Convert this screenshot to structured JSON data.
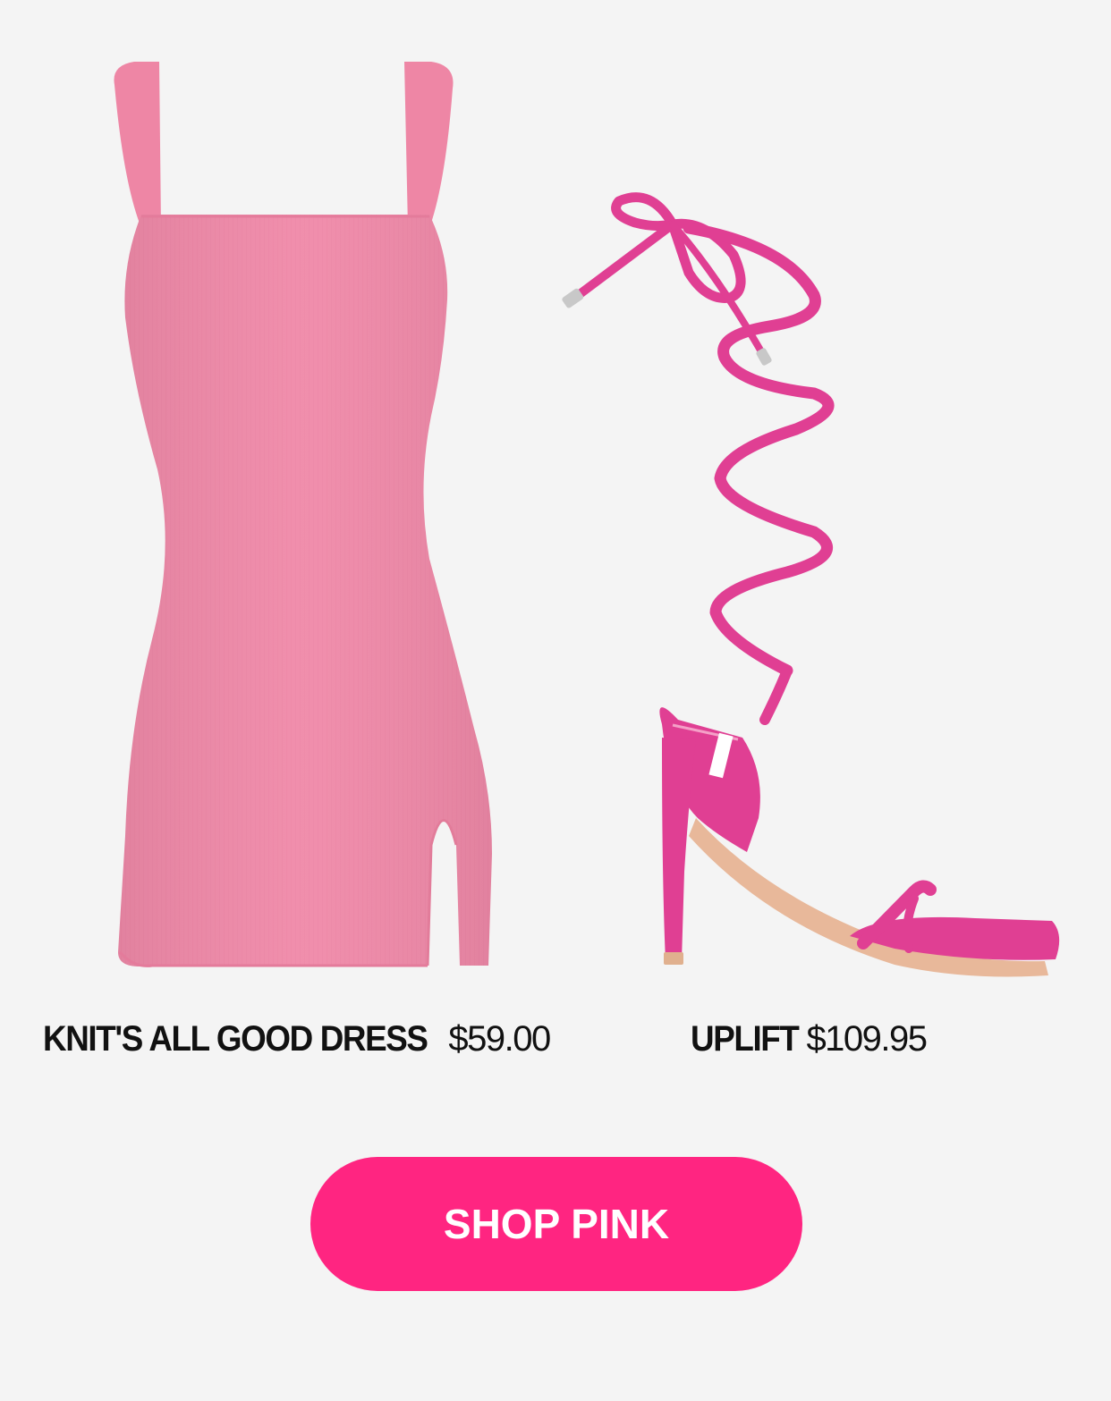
{
  "products": [
    {
      "name": "KNIT'S ALL GOOD DRESS",
      "price": "$59.00",
      "image_icon": "pink-bodycon-dress-image",
      "color": "#f08aa9"
    },
    {
      "name": "UPLIFT",
      "price": "$109.95",
      "image_icon": "pink-lace-up-heel-image",
      "color": "#e03f93"
    }
  ],
  "cta": {
    "label": "SHOP PINK",
    "color": "#ff2581"
  },
  "background_color": "#f4f4f4"
}
